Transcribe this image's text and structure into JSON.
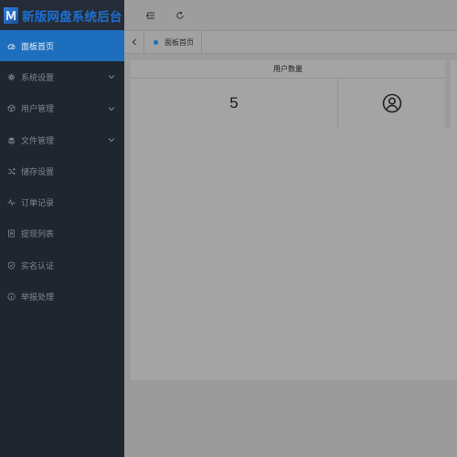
{
  "app": {
    "title": "新版网盘系统后台"
  },
  "sidebar": {
    "items": [
      {
        "label": "面板首页",
        "icon": "dashboard-icon",
        "active": true,
        "has_children": false
      },
      {
        "label": "系统设置",
        "icon": "gear-icon",
        "active": false,
        "has_children": true
      },
      {
        "label": "用户管理",
        "icon": "box-icon",
        "active": false,
        "has_children": true
      },
      {
        "label": "文件管理",
        "icon": "layers-icon",
        "active": false,
        "has_children": true
      },
      {
        "label": "储存设置",
        "icon": "shuffle-icon",
        "active": false,
        "has_children": false
      },
      {
        "label": "订单记录",
        "icon": "pulse-icon",
        "active": false,
        "has_children": false
      },
      {
        "label": "提现列表",
        "icon": "document-icon",
        "active": false,
        "has_children": false
      },
      {
        "label": "实名认证",
        "icon": "shield-icon",
        "active": false,
        "has_children": false
      },
      {
        "label": "举报处理",
        "icon": "info-icon",
        "active": false,
        "has_children": false
      }
    ]
  },
  "header": {
    "fold_icon": "menu-fold-icon",
    "refresh_icon": "refresh-icon"
  },
  "tabs": {
    "back_icon": "chevron-left-icon",
    "items": [
      {
        "label": "面板首页",
        "active": true
      }
    ]
  },
  "dashboard": {
    "user_count_card": {
      "title": "用户数量",
      "value": "5",
      "icon": "user-circle-icon"
    }
  },
  "colors": {
    "sidebar_bg": "#1f2630",
    "active_item": "#1d6fbe",
    "logo_text": "#1e6fd0",
    "tab_dot": "#1a6bbd"
  }
}
